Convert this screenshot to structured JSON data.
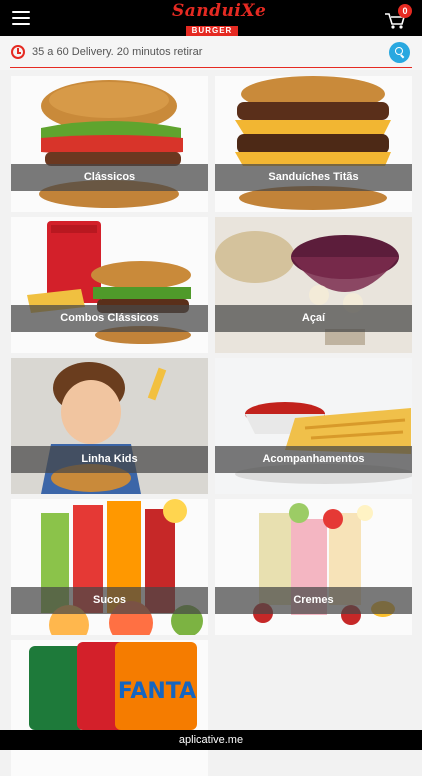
{
  "header": {
    "logo_top": "SanduiXe",
    "logo_bottom": "BURGER",
    "cart_count": "0"
  },
  "info": {
    "delivery": "35 a 60 Delivery. 20 minutos retirar"
  },
  "categories": [
    {
      "label": "Clássicos"
    },
    {
      "label": "Sanduíches Titãs"
    },
    {
      "label": "Combos Clássicos"
    },
    {
      "label": "Açaí"
    },
    {
      "label": "Linha Kids"
    },
    {
      "label": "Acompanhamentos"
    },
    {
      "label": "Sucos"
    },
    {
      "label": "Cremes"
    },
    {
      "label": ""
    }
  ],
  "footer": {
    "text": "aplicative.me"
  },
  "colors": {
    "brand_red": "#e52a22",
    "accent_blue": "#29a8e0"
  }
}
